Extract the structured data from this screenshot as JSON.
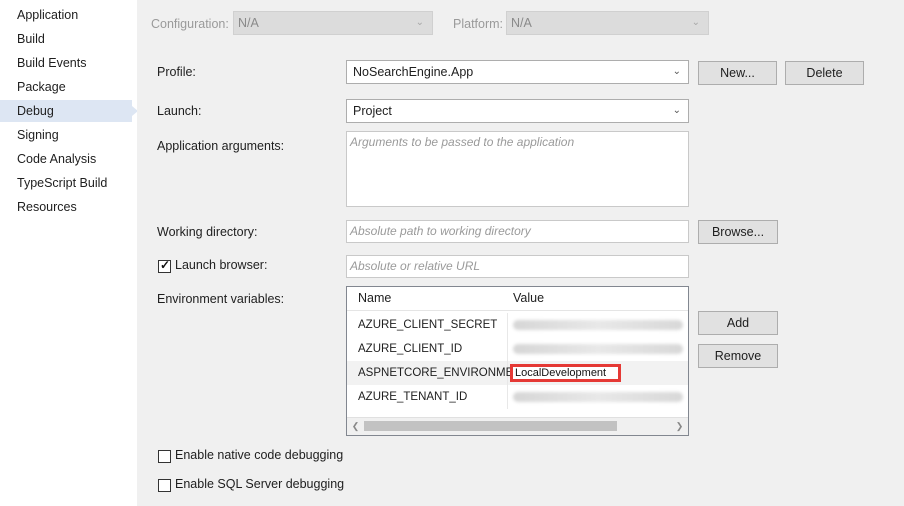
{
  "sidebar": {
    "items": [
      {
        "label": "Application"
      },
      {
        "label": "Build"
      },
      {
        "label": "Build Events"
      },
      {
        "label": "Package"
      },
      {
        "label": "Debug"
      },
      {
        "label": "Signing"
      },
      {
        "label": "Code Analysis"
      },
      {
        "label": "TypeScript Build"
      },
      {
        "label": "Resources"
      }
    ],
    "selected": "Debug"
  },
  "topbar": {
    "configuration_label": "Configuration:",
    "configuration_value": "N/A",
    "platform_label": "Platform:",
    "platform_value": "N/A"
  },
  "profile": {
    "label": "Profile:",
    "value": "NoSearchEngine.App",
    "new_button": "New...",
    "delete_button": "Delete"
  },
  "launch": {
    "label": "Launch:",
    "value": "Project"
  },
  "app_args": {
    "label": "Application arguments:",
    "placeholder": "Arguments to be passed to the application"
  },
  "working_dir": {
    "label": "Working directory:",
    "placeholder": "Absolute path to working directory",
    "browse_button": "Browse..."
  },
  "launch_browser": {
    "label": "Launch browser:",
    "checked": true,
    "placeholder": "Absolute or relative URL"
  },
  "env": {
    "label": "Environment variables:",
    "columns": [
      "Name",
      "Value"
    ],
    "rows": [
      {
        "name": "AZURE_CLIENT_SECRET",
        "value": ""
      },
      {
        "name": "AZURE_CLIENT_ID",
        "value": ""
      },
      {
        "name": "ASPNETCORE_ENVIRONMENT",
        "value": "LocalDevelopment"
      },
      {
        "name": "AZURE_TENANT_ID",
        "value": ""
      }
    ],
    "add_button": "Add",
    "remove_button": "Remove"
  },
  "native_debugging": {
    "label": "Enable native code debugging",
    "checked": false
  },
  "sql_debugging": {
    "label": "Enable SQL Server debugging",
    "checked": false
  },
  "colors": {
    "sidebar_selected": "#dde6f3",
    "panel_bg": "#f0f0f0",
    "highlight_border": "#e53935"
  },
  "icons": {
    "dropdown": "chevron-down-icon",
    "checkbox_checked": "checkmark-icon",
    "scroll_left": "arrow-left-icon",
    "scroll_right": "arrow-right-icon"
  }
}
